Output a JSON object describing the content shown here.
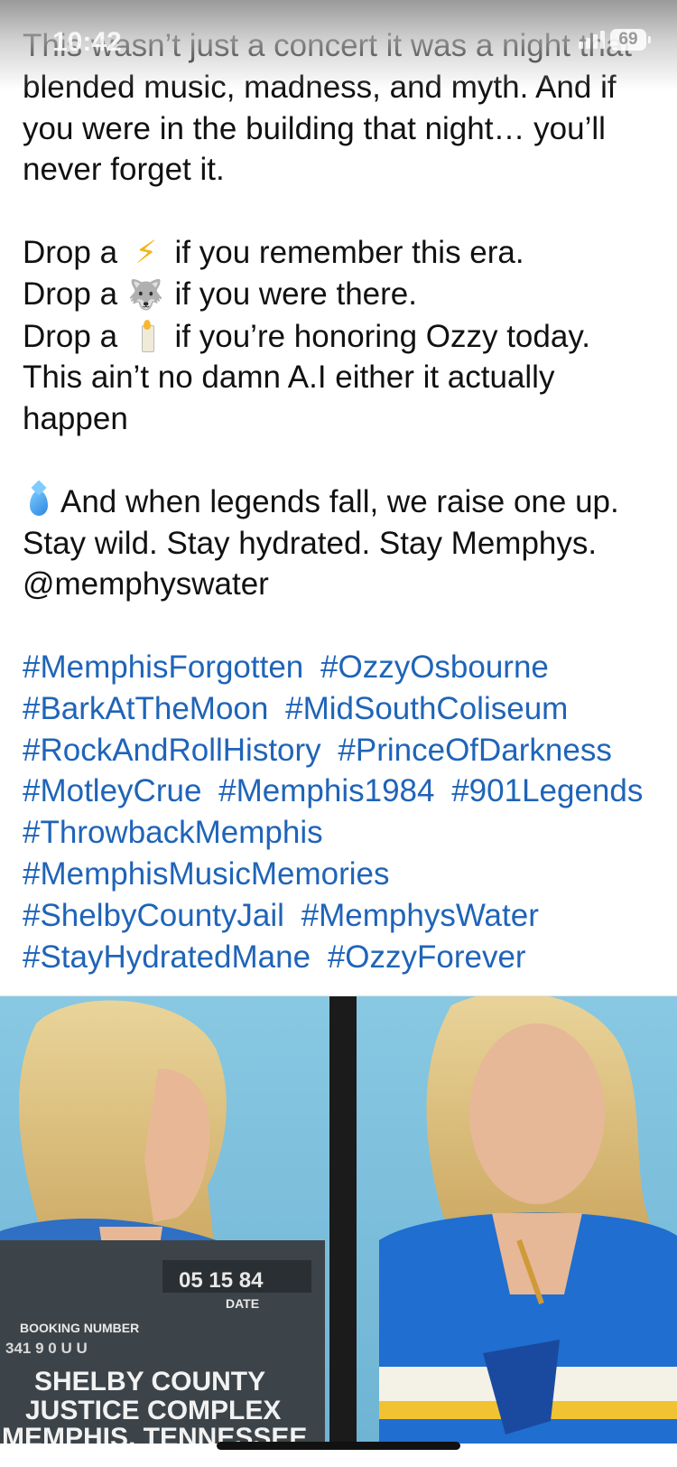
{
  "status_bar": {
    "time": "10:42",
    "battery": "69"
  },
  "post": {
    "intro_lines": [
      "This wasn’t just a concert it was a night that blended music, madness, and myth. And if you were in the building that night… you’ll never forget it."
    ],
    "drop_lines": [
      {
        "prefix": "Drop a",
        "emoji": "⚡",
        "icon": "lightning-icon",
        "suffix": "if you remember this era."
      },
      {
        "prefix": "Drop a",
        "emoji": "🐺",
        "icon": "wolf-icon",
        "suffix": "if you were there."
      },
      {
        "prefix": "Drop a",
        "emoji": "🕯️",
        "icon": "candle-icon",
        "suffix": "if you’re honoring Ozzy today."
      }
    ],
    "ai_line": "This ain’t no damn A.I either it actually happen",
    "closing_emoji": "💧",
    "closing_text": "And when legends fall, we raise one up. Stay wild. Stay hydrated. Stay Memphys. @memphyswater",
    "hashtags": [
      "#MemphisForgotten",
      "#OzzyOsbourne",
      "#BarkAtTheMoon",
      "#MidSouthColiseum",
      "#RockAndRollHistory",
      "#PrinceOfDarkness",
      "#MotleyCrue",
      "#Memphis1984",
      "#901Legends",
      "#ThrowbackMemphis",
      "#MemphisMusicMemories",
      "#ShelbyCountyJail",
      "#MemphysWater",
      "#StayHydratedMane",
      "#OzzyForever"
    ]
  },
  "photo": {
    "date_value": "05 15 84",
    "date_label": "DATE",
    "booking_label": "BOOKING NUMBER",
    "booking_value": "341 9 0 U U",
    "placard_line1": "SHELBY COUNTY",
    "placard_line2": "JUSTICE COMPLEX",
    "placard_line3": "MEMPHIS, TENNESSEE"
  },
  "colors": {
    "hashtag": "#1f64b8",
    "text": "#111111",
    "photo_bg": "#7fc0dc"
  }
}
